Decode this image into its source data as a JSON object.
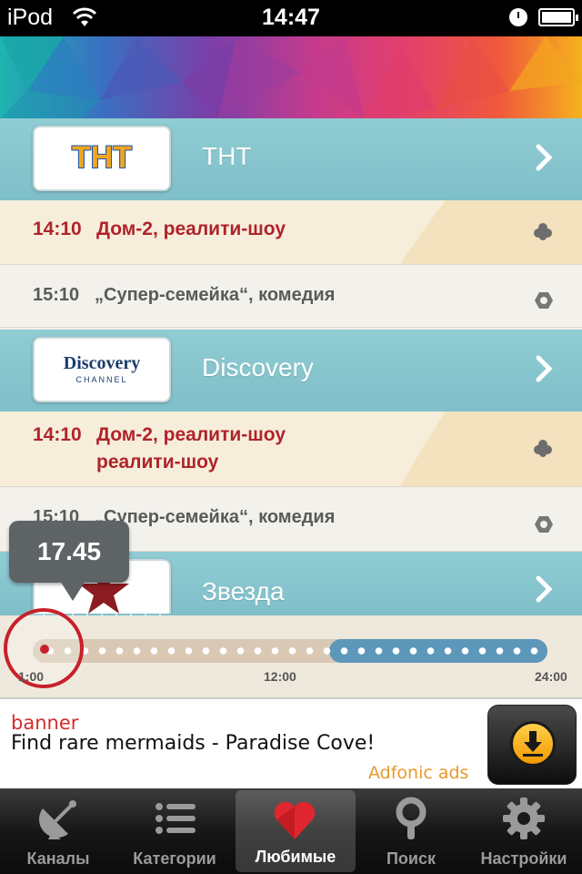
{
  "status_bar": {
    "carrier": "iPod",
    "time": "14:47",
    "wifi_icon": "wifi-icon",
    "clock_icon": "alarm-clock-icon",
    "battery_icon": "battery-icon",
    "battery_level": 1.0
  },
  "channels": [
    {
      "name": "ТНТ",
      "logo_text": "ТНТ",
      "programs": [
        {
          "state": "current",
          "time": "14:10",
          "title": "Дом-2, реалити-шоу",
          "icon": "reminder-flower-icon"
        },
        {
          "state": "next",
          "time": "15:10",
          "title": "„Супер-семейка“, комедия",
          "icon": "hex-nut-icon"
        }
      ]
    },
    {
      "name": "Discovery",
      "logo_text": "Discovery",
      "logo_subtext": "CHANNEL",
      "programs": [
        {
          "state": "current",
          "time": "14:10",
          "title": "Дом-2, реалити-шоу",
          "title_line2": "реалити-шоу",
          "icon": "reminder-flower-icon"
        },
        {
          "state": "next",
          "time": "15:10",
          "title": "„Супер-семейка“, комедия",
          "icon": "hex-nut-icon"
        }
      ]
    },
    {
      "name": "Звезда",
      "logo_icon": "star-icon"
    }
  ],
  "timeline": {
    "tooltip": "17.45",
    "start_label": "1:00",
    "mid_label": "12:00",
    "end_label": "24:00",
    "future_color": "#5d97ba",
    "past_color": "#d9c9b4",
    "marker_color": "#c8202a"
  },
  "ad": {
    "label": "banner",
    "text": "Find rare mermaids - Paradise Cove!",
    "source": "Adfonic ads",
    "button_icon": "download-arrow-icon"
  },
  "tabs": [
    {
      "label": "Каналы",
      "icon": "satellite-dish-icon",
      "active": false
    },
    {
      "label": "Категории",
      "icon": "list-icon",
      "active": false
    },
    {
      "label": "Любимые",
      "icon": "heart-icon",
      "active": true
    },
    {
      "label": "Поиск",
      "icon": "magnifier-icon",
      "active": false
    },
    {
      "label": "Настройки",
      "icon": "gear-icon",
      "active": false
    }
  ]
}
